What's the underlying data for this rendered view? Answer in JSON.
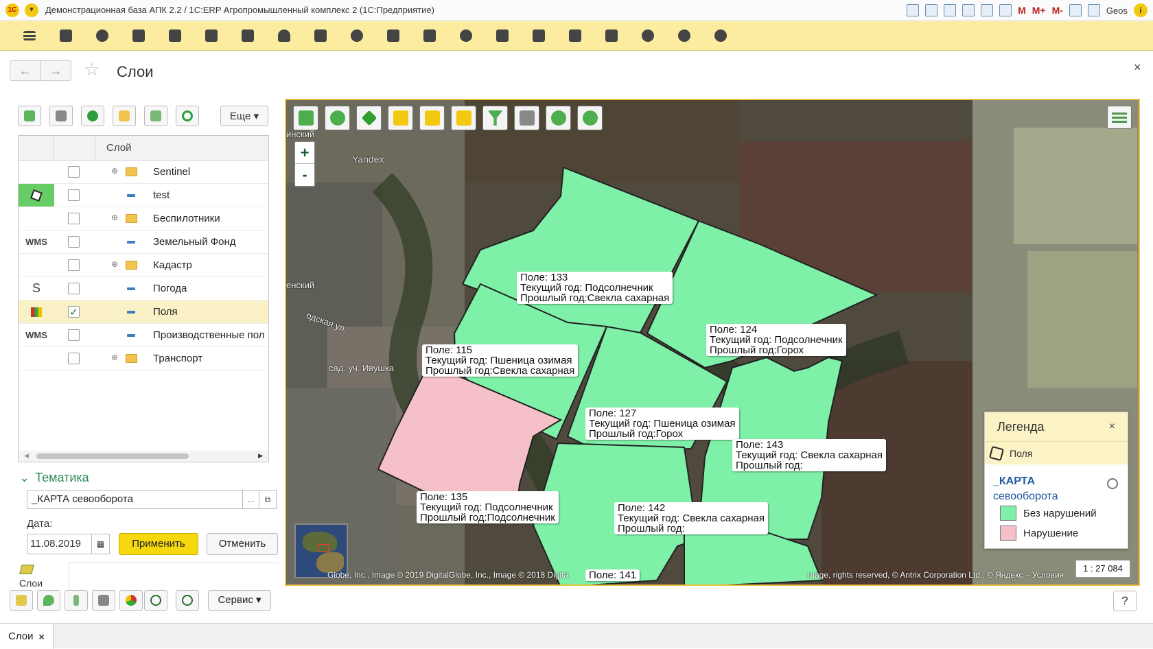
{
  "window": {
    "title": "Демонстрационная база АПК 2.2 / 1С:ERP Агропромышленный комплекс 2  (1С:Предприятие)",
    "user": "Geos",
    "memory_buttons": [
      "M",
      "M+",
      "M-"
    ],
    "logo_text": "1С"
  },
  "page": {
    "title": "Слои",
    "close": "×"
  },
  "toolbar": {
    "more_label": "Еще"
  },
  "tree": {
    "column_header": "Слой",
    "rows": [
      {
        "icon": "",
        "checked": false,
        "type": "folder",
        "label": "Sentinel"
      },
      {
        "icon": "polygon",
        "checked": false,
        "type": "layer",
        "label": "test"
      },
      {
        "icon": "",
        "checked": false,
        "type": "folder",
        "label": "Беспилотники"
      },
      {
        "icon": "WMS",
        "checked": false,
        "type": "layer",
        "label": "Земельный Фонд"
      },
      {
        "icon": "",
        "checked": false,
        "type": "folder",
        "label": "Кадастр"
      },
      {
        "icon": "S",
        "checked": false,
        "type": "layer",
        "label": "Погода"
      },
      {
        "icon": "chart",
        "checked": true,
        "type": "layer",
        "label": "Поля"
      },
      {
        "icon": "WMS",
        "checked": false,
        "type": "layer",
        "label": "Производственные пол"
      },
      {
        "icon": "",
        "checked": false,
        "type": "folder",
        "label": "Транспорт"
      }
    ],
    "check_mark": "✓",
    "expand_mark": "⊕"
  },
  "thematic": {
    "header": "Тематика",
    "value": "_КАРТА севооборота",
    "dots": "...",
    "date_label": "Дата:",
    "date_value": "11.08.2019",
    "apply_label": "Применить",
    "cancel_label": "Отменить"
  },
  "layers_mini": {
    "label": "Слои"
  },
  "bottom": {
    "service_label": "Сервис",
    "help_label": "?"
  },
  "tabs": [
    {
      "label": "Слои",
      "close": "×"
    }
  ],
  "map": {
    "zoom_in": "+",
    "zoom_out": "-",
    "watermark": "Yandex",
    "place_labels": [
      "инский",
      "енский",
      "одская ул.",
      "сад. уч. Ивушка"
    ],
    "attribution": "Globe, Inc., Image © 2019 DigitalGlobe, Inc., Image © 2018 Digita",
    "attribution_right": "mage, rights reserved, © Antrix Corporation Ltd., © Яндекс – Условия",
    "scale": "1 : 27 084",
    "fields": [
      {
        "name": "Поле: 133",
        "current": "Текущий год: Подсолнечник",
        "previous": "Прошлый год:Свекла сахарная",
        "status": "ok"
      },
      {
        "name": "Поле: 124",
        "current": "Текущий год: Подсолнечник",
        "previous": "Прошлый год:Горох",
        "status": "ok"
      },
      {
        "name": "Поле: 115",
        "current": "Текущий год: Пшеница озимая",
        "previous": "Прошлый год:Свекла сахарная",
        "status": "ok"
      },
      {
        "name": "Поле: 127",
        "current": "Текущий год: Пшеница озимая",
        "previous": "Прошлый год:Горох",
        "status": "ok"
      },
      {
        "name": "Поле: 143",
        "current": "Текущий год: Свекла сахарная",
        "previous": "Прошлый год:",
        "status": "ok"
      },
      {
        "name": "Поле: 135",
        "current": "Текущий год: Подсолнечник",
        "previous": "Прошлый год:Подсолнечник",
        "status": "violation"
      },
      {
        "name": "Поле: 142",
        "current": "Текущий год: Свекла сахарная",
        "previous": "Прошлый год:",
        "status": "ok"
      },
      {
        "name": "Поле: 141",
        "current": "",
        "previous": "",
        "status": "ok"
      }
    ],
    "colors": {
      "ok": "#7ff0a8",
      "violation": "#f5c0c8",
      "accent": "#f0c040"
    }
  },
  "legend": {
    "title": "Легенда",
    "close": "×",
    "layer": "Поля",
    "theme_line1": "_КАРТА",
    "theme_line2": "севооборота",
    "items": [
      {
        "label": "Без нарушений",
        "color": "#7ff0a8"
      },
      {
        "label": "Нарушение",
        "color": "#f5c0c8"
      }
    ]
  }
}
